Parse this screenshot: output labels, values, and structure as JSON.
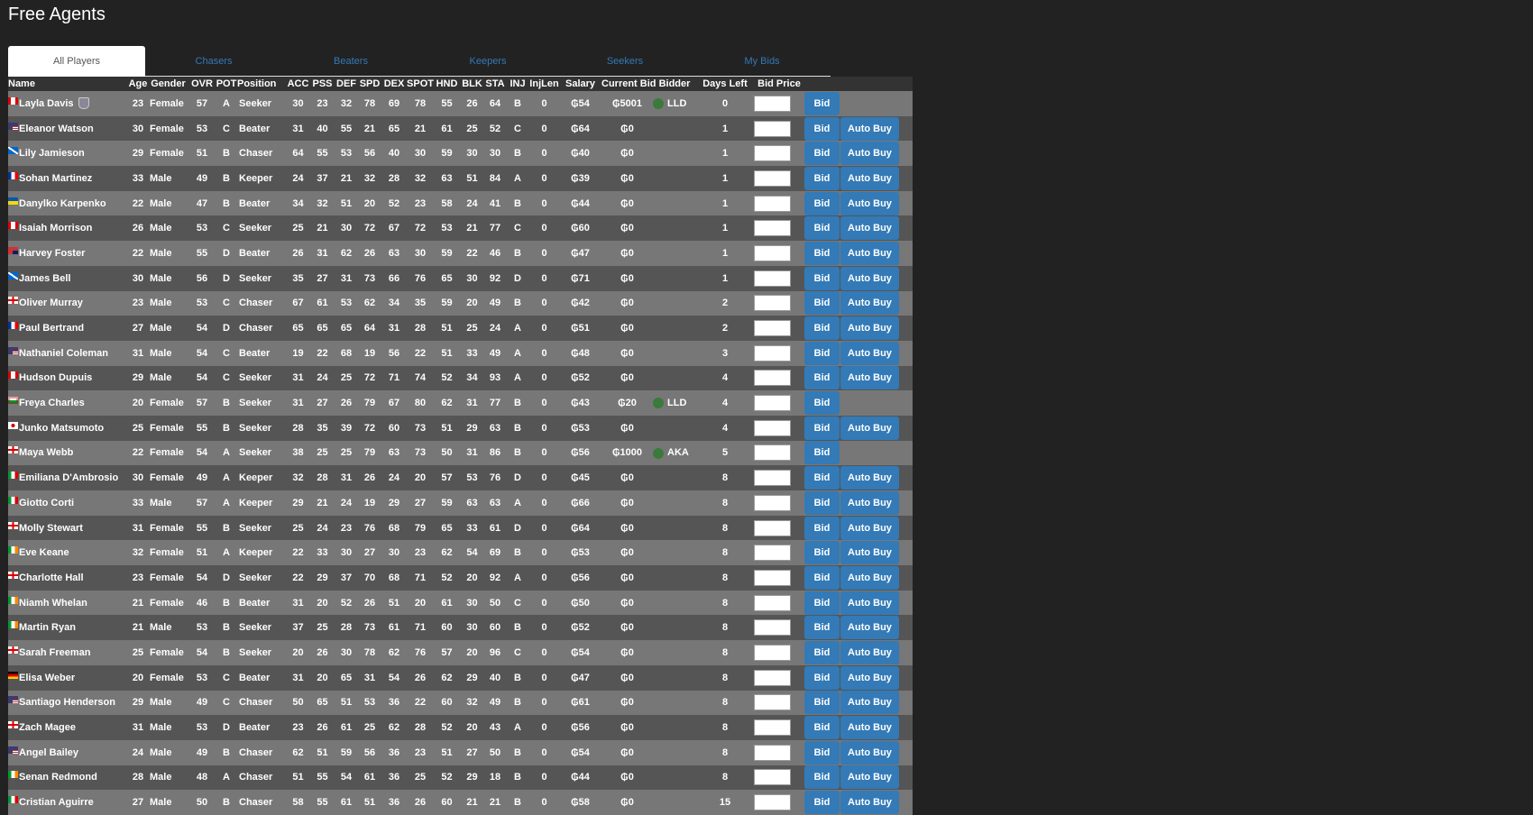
{
  "page": {
    "title": "Free Agents"
  },
  "tabs": [
    {
      "label": "All Players",
      "active": true
    },
    {
      "label": "Chasers"
    },
    {
      "label": "Beaters"
    },
    {
      "label": "Keepers"
    },
    {
      "label": "Seekers"
    },
    {
      "label": "My Bids"
    }
  ],
  "colors": {
    "accent": "#337ab7",
    "row_light": "#777777",
    "row_dark": "#555555",
    "header": "#333333",
    "background": "#222222"
  },
  "columns": [
    "Name",
    "Age",
    "Gender",
    "OVR",
    "POT",
    "Position",
    "ACC",
    "PSS",
    "DEF",
    "SPD",
    "DEX",
    "SPOT",
    "HND",
    "BLK",
    "STA",
    "INJ",
    "InjLen",
    "Salary",
    "Current Bid",
    "Bidder",
    "Days Left",
    "Bid Price"
  ],
  "buttons": {
    "bid": "Bid",
    "auto_buy": "Auto Buy"
  },
  "players": [
    {
      "flag": "CA",
      "name": "Layla Davis",
      "badge": "team-crest-icon",
      "age": 23,
      "gender": "Female",
      "ovr": 57,
      "pot": "A",
      "pos": "Seeker",
      "acc": 30,
      "pss": 23,
      "def": 32,
      "spd": 78,
      "dex": 69,
      "spot": 78,
      "hnd": 55,
      "blk": 26,
      "sta": 64,
      "inj": "B",
      "injlen": 0,
      "salary": "₲54",
      "bid": "₲5001",
      "bidder": "LLD",
      "days": 0,
      "auto": false
    },
    {
      "flag": "US",
      "name": "Eleanor Watson",
      "age": 30,
      "gender": "Female",
      "ovr": 53,
      "pot": "C",
      "pos": "Beater",
      "acc": 31,
      "pss": 40,
      "def": 55,
      "spd": 21,
      "dex": 65,
      "spot": 21,
      "hnd": 61,
      "blk": 25,
      "sta": 52,
      "inj": "C",
      "injlen": 0,
      "salary": "₲64",
      "bid": "₲0",
      "days": 1,
      "auto": true
    },
    {
      "flag": "SC",
      "name": "Lily Jamieson",
      "age": 29,
      "gender": "Female",
      "ovr": 51,
      "pot": "B",
      "pos": "Chaser",
      "acc": 64,
      "pss": 55,
      "def": 53,
      "spd": 56,
      "dex": 40,
      "spot": 30,
      "hnd": 59,
      "blk": 30,
      "sta": 30,
      "inj": "B",
      "injlen": 0,
      "salary": "₲40",
      "bid": "₲0",
      "days": 1,
      "auto": true
    },
    {
      "flag": "FR",
      "name": "Sohan Martinez",
      "age": 33,
      "gender": "Male",
      "ovr": 49,
      "pot": "B",
      "pos": "Keeper",
      "acc": 24,
      "pss": 37,
      "def": 21,
      "spd": 32,
      "dex": 28,
      "spot": 32,
      "hnd": 63,
      "blk": 51,
      "sta": 84,
      "inj": "A",
      "injlen": 0,
      "salary": "₲39",
      "bid": "₲0",
      "days": 1,
      "auto": true
    },
    {
      "flag": "UA",
      "name": "Danylko Karpenko",
      "age": 22,
      "gender": "Male",
      "ovr": 47,
      "pot": "B",
      "pos": "Beater",
      "acc": 34,
      "pss": 32,
      "def": 51,
      "spd": 20,
      "dex": 52,
      "spot": 23,
      "hnd": 58,
      "blk": 24,
      "sta": 41,
      "inj": "B",
      "injlen": 0,
      "salary": "₲44",
      "bid": "₲0",
      "days": 1,
      "auto": true
    },
    {
      "flag": "CA",
      "name": "Isaiah Morrison",
      "age": 26,
      "gender": "Male",
      "ovr": 53,
      "pot": "C",
      "pos": "Seeker",
      "acc": 25,
      "pss": 21,
      "def": 30,
      "spd": 72,
      "dex": 67,
      "spot": 72,
      "hnd": 53,
      "blk": 21,
      "sta": 77,
      "inj": "C",
      "injlen": 0,
      "salary": "₲60",
      "bid": "₲0",
      "days": 1,
      "auto": true
    },
    {
      "flag": "AU",
      "name": "Harvey Foster",
      "age": 22,
      "gender": "Male",
      "ovr": 55,
      "pot": "D",
      "pos": "Beater",
      "acc": 26,
      "pss": 31,
      "def": 62,
      "spd": 26,
      "dex": 63,
      "spot": 30,
      "hnd": 59,
      "blk": 22,
      "sta": 46,
      "inj": "B",
      "injlen": 0,
      "salary": "₲47",
      "bid": "₲0",
      "days": 1,
      "auto": true
    },
    {
      "flag": "SC",
      "name": "James Bell",
      "age": 30,
      "gender": "Male",
      "ovr": 56,
      "pot": "D",
      "pos": "Seeker",
      "acc": 35,
      "pss": 27,
      "def": 31,
      "spd": 73,
      "dex": 66,
      "spot": 76,
      "hnd": 65,
      "blk": 30,
      "sta": 92,
      "inj": "D",
      "injlen": 0,
      "salary": "₲71",
      "bid": "₲0",
      "days": 1,
      "auto": true
    },
    {
      "flag": "EN",
      "name": "Oliver Murray",
      "age": 23,
      "gender": "Male",
      "ovr": 53,
      "pot": "C",
      "pos": "Chaser",
      "acc": 67,
      "pss": 61,
      "def": 53,
      "spd": 62,
      "dex": 34,
      "spot": 35,
      "hnd": 59,
      "blk": 20,
      "sta": 49,
      "inj": "B",
      "injlen": 0,
      "salary": "₲42",
      "bid": "₲0",
      "days": 2,
      "auto": true
    },
    {
      "flag": "FR",
      "name": "Paul Bertrand",
      "age": 27,
      "gender": "Male",
      "ovr": 54,
      "pot": "D",
      "pos": "Chaser",
      "acc": 65,
      "pss": 65,
      "def": 65,
      "spd": 64,
      "dex": 31,
      "spot": 28,
      "hnd": 51,
      "blk": 25,
      "sta": 24,
      "inj": "A",
      "injlen": 0,
      "salary": "₲51",
      "bid": "₲0",
      "days": 2,
      "auto": true
    },
    {
      "flag": "US",
      "name": "Nathaniel Coleman",
      "age": 31,
      "gender": "Male",
      "ovr": 54,
      "pot": "C",
      "pos": "Beater",
      "acc": 19,
      "pss": 22,
      "def": 68,
      "spd": 19,
      "dex": 56,
      "spot": 22,
      "hnd": 51,
      "blk": 33,
      "sta": 49,
      "inj": "A",
      "injlen": 0,
      "salary": "₲48",
      "bid": "₲0",
      "days": 3,
      "auto": true
    },
    {
      "flag": "CA",
      "name": "Hudson Dupuis",
      "age": 29,
      "gender": "Male",
      "ovr": 54,
      "pot": "C",
      "pos": "Seeker",
      "acc": 31,
      "pss": 24,
      "def": 25,
      "spd": 72,
      "dex": 71,
      "spot": 74,
      "hnd": 52,
      "blk": 34,
      "sta": 93,
      "inj": "A",
      "injlen": 0,
      "salary": "₲52",
      "bid": "₲0",
      "days": 4,
      "auto": true
    },
    {
      "flag": "WA",
      "name": "Freya Charles",
      "age": 20,
      "gender": "Female",
      "ovr": 57,
      "pot": "B",
      "pos": "Seeker",
      "acc": 31,
      "pss": 27,
      "def": 26,
      "spd": 79,
      "dex": 67,
      "spot": 80,
      "hnd": 62,
      "blk": 31,
      "sta": 77,
      "inj": "B",
      "injlen": 0,
      "salary": "₲43",
      "bid": "₲20",
      "bidder": "LLD",
      "days": 4,
      "auto": false
    },
    {
      "flag": "JP",
      "name": "Junko Matsumoto",
      "age": 25,
      "gender": "Female",
      "ovr": 55,
      "pot": "B",
      "pos": "Seeker",
      "acc": 28,
      "pss": 35,
      "def": 39,
      "spd": 72,
      "dex": 60,
      "spot": 73,
      "hnd": 51,
      "blk": 29,
      "sta": 63,
      "inj": "B",
      "injlen": 0,
      "salary": "₲53",
      "bid": "₲0",
      "days": 4,
      "auto": true
    },
    {
      "flag": "EN",
      "name": "Maya Webb",
      "age": 22,
      "gender": "Female",
      "ovr": 54,
      "pot": "A",
      "pos": "Seeker",
      "acc": 38,
      "pss": 25,
      "def": 25,
      "spd": 79,
      "dex": 63,
      "spot": 73,
      "hnd": 50,
      "blk": 31,
      "sta": 86,
      "inj": "B",
      "injlen": 0,
      "salary": "₲56",
      "bid": "₲1000",
      "bidder": "AKA",
      "days": 5,
      "auto": false
    },
    {
      "flag": "IT",
      "name": "Emiliana D'Ambrosio",
      "age": 30,
      "gender": "Female",
      "ovr": 49,
      "pot": "A",
      "pos": "Keeper",
      "acc": 32,
      "pss": 28,
      "def": 31,
      "spd": 26,
      "dex": 24,
      "spot": 20,
      "hnd": 57,
      "blk": 53,
      "sta": 76,
      "inj": "D",
      "injlen": 0,
      "salary": "₲45",
      "bid": "₲0",
      "days": 8,
      "auto": true
    },
    {
      "flag": "IT",
      "name": "Giotto Corti",
      "age": 33,
      "gender": "Male",
      "ovr": 57,
      "pot": "A",
      "pos": "Keeper",
      "acc": 29,
      "pss": 21,
      "def": 24,
      "spd": 19,
      "dex": 29,
      "spot": 27,
      "hnd": 59,
      "blk": 63,
      "sta": 63,
      "inj": "A",
      "injlen": 0,
      "salary": "₲66",
      "bid": "₲0",
      "days": 8,
      "auto": true
    },
    {
      "flag": "EN",
      "name": "Molly Stewart",
      "age": 31,
      "gender": "Female",
      "ovr": 55,
      "pot": "B",
      "pos": "Seeker",
      "acc": 25,
      "pss": 24,
      "def": 23,
      "spd": 76,
      "dex": 68,
      "spot": 79,
      "hnd": 65,
      "blk": 33,
      "sta": 61,
      "inj": "D",
      "injlen": 0,
      "salary": "₲64",
      "bid": "₲0",
      "days": 8,
      "auto": true
    },
    {
      "flag": "IE",
      "name": "Eve Keane",
      "age": 32,
      "gender": "Female",
      "ovr": 51,
      "pot": "A",
      "pos": "Keeper",
      "acc": 22,
      "pss": 33,
      "def": 30,
      "spd": 27,
      "dex": 30,
      "spot": 23,
      "hnd": 62,
      "blk": 54,
      "sta": 69,
      "inj": "B",
      "injlen": 0,
      "salary": "₲53",
      "bid": "₲0",
      "days": 8,
      "auto": true
    },
    {
      "flag": "EN",
      "name": "Charlotte Hall",
      "age": 23,
      "gender": "Female",
      "ovr": 54,
      "pot": "D",
      "pos": "Seeker",
      "acc": 22,
      "pss": 29,
      "def": 37,
      "spd": 70,
      "dex": 68,
      "spot": 71,
      "hnd": 52,
      "blk": 20,
      "sta": 92,
      "inj": "A",
      "injlen": 0,
      "salary": "₲56",
      "bid": "₲0",
      "days": 8,
      "auto": true
    },
    {
      "flag": "IE",
      "name": "Niamh Whelan",
      "age": 21,
      "gender": "Female",
      "ovr": 46,
      "pot": "B",
      "pos": "Beater",
      "acc": 31,
      "pss": 20,
      "def": 52,
      "spd": 26,
      "dex": 51,
      "spot": 20,
      "hnd": 61,
      "blk": 30,
      "sta": 50,
      "inj": "C",
      "injlen": 0,
      "salary": "₲50",
      "bid": "₲0",
      "days": 8,
      "auto": true
    },
    {
      "flag": "IE",
      "name": "Martin Ryan",
      "age": 21,
      "gender": "Male",
      "ovr": 53,
      "pot": "B",
      "pos": "Seeker",
      "acc": 37,
      "pss": 25,
      "def": 28,
      "spd": 73,
      "dex": 61,
      "spot": 71,
      "hnd": 60,
      "blk": 30,
      "sta": 60,
      "inj": "B",
      "injlen": 0,
      "salary": "₲52",
      "bid": "₲0",
      "days": 8,
      "auto": true
    },
    {
      "flag": "EN",
      "name": "Sarah Freeman",
      "age": 25,
      "gender": "Female",
      "ovr": 54,
      "pot": "B",
      "pos": "Seeker",
      "acc": 20,
      "pss": 26,
      "def": 30,
      "spd": 78,
      "dex": 62,
      "spot": 76,
      "hnd": 57,
      "blk": 20,
      "sta": 96,
      "inj": "C",
      "injlen": 0,
      "salary": "₲54",
      "bid": "₲0",
      "days": 8,
      "auto": true
    },
    {
      "flag": "DE",
      "name": "Elisa Weber",
      "age": 20,
      "gender": "Female",
      "ovr": 53,
      "pot": "C",
      "pos": "Beater",
      "acc": 31,
      "pss": 20,
      "def": 65,
      "spd": 31,
      "dex": 54,
      "spot": 26,
      "hnd": 62,
      "blk": 29,
      "sta": 40,
      "inj": "B",
      "injlen": 0,
      "salary": "₲47",
      "bid": "₲0",
      "days": 8,
      "auto": true
    },
    {
      "flag": "US",
      "name": "Santiago Henderson",
      "age": 29,
      "gender": "Male",
      "ovr": 49,
      "pot": "C",
      "pos": "Chaser",
      "acc": 50,
      "pss": 65,
      "def": 51,
      "spd": 53,
      "dex": 36,
      "spot": 22,
      "hnd": 60,
      "blk": 32,
      "sta": 49,
      "inj": "B",
      "injlen": 0,
      "salary": "₲61",
      "bid": "₲0",
      "days": 8,
      "auto": true
    },
    {
      "flag": "EN",
      "name": "Zach Magee",
      "age": 31,
      "gender": "Male",
      "ovr": 53,
      "pot": "D",
      "pos": "Beater",
      "acc": 23,
      "pss": 26,
      "def": 61,
      "spd": 25,
      "dex": 62,
      "spot": 28,
      "hnd": 52,
      "blk": 20,
      "sta": 43,
      "inj": "A",
      "injlen": 0,
      "salary": "₲56",
      "bid": "₲0",
      "days": 8,
      "auto": true
    },
    {
      "flag": "US",
      "name": "Angel Bailey",
      "age": 24,
      "gender": "Male",
      "ovr": 49,
      "pot": "B",
      "pos": "Chaser",
      "acc": 62,
      "pss": 51,
      "def": 59,
      "spd": 56,
      "dex": 36,
      "spot": 23,
      "hnd": 51,
      "blk": 27,
      "sta": 50,
      "inj": "B",
      "injlen": 0,
      "salary": "₲54",
      "bid": "₲0",
      "days": 8,
      "auto": true
    },
    {
      "flag": "IE",
      "name": "Senan Redmond",
      "age": 28,
      "gender": "Male",
      "ovr": 48,
      "pot": "A",
      "pos": "Chaser",
      "acc": 51,
      "pss": 55,
      "def": 54,
      "spd": 61,
      "dex": 36,
      "spot": 25,
      "hnd": 52,
      "blk": 29,
      "sta": 18,
      "inj": "B",
      "injlen": 0,
      "salary": "₲44",
      "bid": "₲0",
      "days": 8,
      "auto": true
    },
    {
      "flag": "IT",
      "name": "Cristian Aguirre",
      "age": 27,
      "gender": "Male",
      "ovr": 50,
      "pot": "B",
      "pos": "Chaser",
      "acc": 58,
      "pss": 55,
      "def": 61,
      "spd": 51,
      "dex": 36,
      "spot": 26,
      "hnd": 60,
      "blk": 21,
      "sta": 21,
      "inj": "B",
      "injlen": 0,
      "salary": "₲58",
      "bid": "₲0",
      "days": 15,
      "auto": true
    }
  ]
}
